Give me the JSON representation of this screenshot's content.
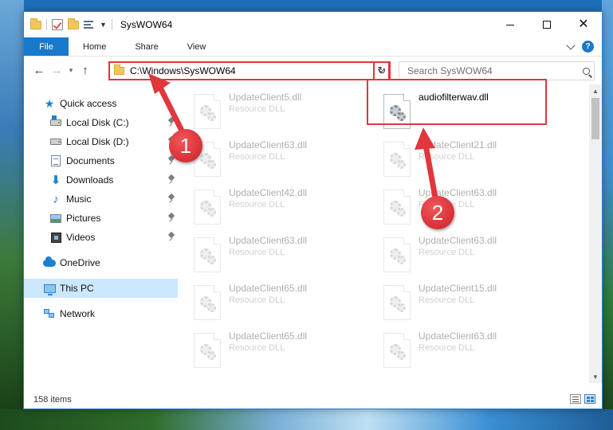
{
  "window": {
    "title": "SysWOW64"
  },
  "ribbon": {
    "tabs": [
      "File",
      "Home",
      "Share",
      "View"
    ]
  },
  "address": {
    "path": "C:\\Windows\\SysWOW64",
    "search_placeholder": "Search SysWOW64"
  },
  "nav": {
    "quick_access": "Quick access",
    "items": [
      {
        "label": "Local Disk (C:)",
        "icon": "drive-c-icon"
      },
      {
        "label": "Local Disk (D:)",
        "icon": "drive-d-icon"
      },
      {
        "label": "Documents",
        "icon": "documents-icon"
      },
      {
        "label": "Downloads",
        "icon": "downloads-icon"
      },
      {
        "label": "Music",
        "icon": "music-icon"
      },
      {
        "label": "Pictures",
        "icon": "pictures-icon"
      },
      {
        "label": "Videos",
        "icon": "videos-icon"
      }
    ],
    "onedrive": "OneDrive",
    "this_pc": "This PC",
    "network": "Network"
  },
  "files": {
    "left_column": [
      {
        "name": "UpdateClient5.dll",
        "type": "Resource DLL"
      },
      {
        "name": "UpdateClient63.dll",
        "type": "Resource DLL"
      },
      {
        "name": "UpdateClient42.dll",
        "type": "Resource DLL"
      },
      {
        "name": "UpdateClient63.dll",
        "type": "Resource DLL"
      },
      {
        "name": "UpdateClient65.dll",
        "type": "Resource DLL"
      },
      {
        "name": "UpdateClient65.dll",
        "type": "Resource DLL"
      }
    ],
    "right_column": [
      {
        "name": "audiofilterwav.dll",
        "type": ""
      },
      {
        "name": "UpdateClient21.dll",
        "type": "Resource DLL"
      },
      {
        "name": "UpdateClient63.dll",
        "type": "Resource DLL"
      },
      {
        "name": "UpdateClient63.dll",
        "type": "Resource DLL"
      },
      {
        "name": "UpdateClient15.dll",
        "type": "Resource DLL"
      },
      {
        "name": "UpdateClient63.dll",
        "type": "Resource DLL"
      }
    ]
  },
  "status": {
    "item_count": "158 items"
  },
  "annotations": {
    "step1": "1",
    "step2": "2",
    "color": "#e0363c"
  }
}
